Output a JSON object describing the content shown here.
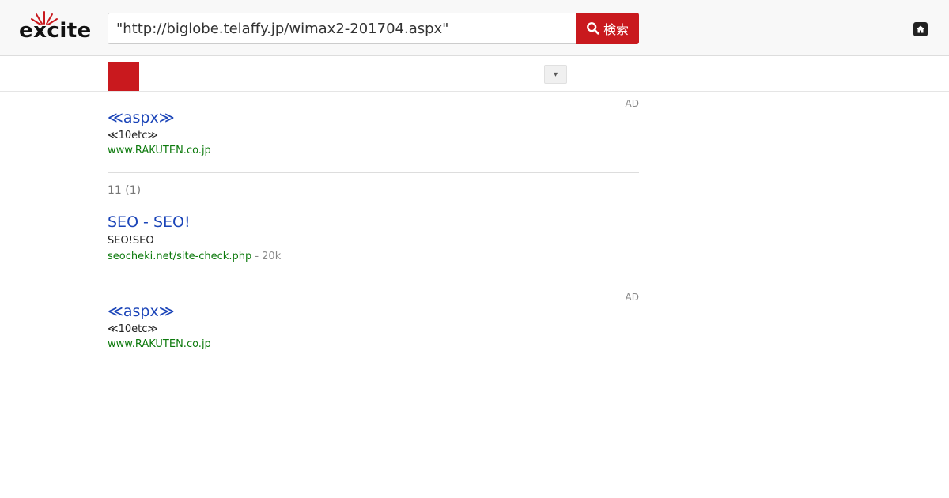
{
  "header": {
    "logo_text": "excite",
    "search_value": "\"http://biglobe.telaffy.jp/wimax2-201704.aspx\"",
    "search_button_label": "検索",
    "brand_color": "#c9191e"
  },
  "tabs": {
    "dropdown_label": "▾"
  },
  "results": {
    "ad_top": {
      "ad_label": "AD",
      "title": "≪aspx≫",
      "desc": "≪10etc≫",
      "url": "www.RAKUTEN.co.jp"
    },
    "count_text": "11 (1)",
    "organic": [
      {
        "title": "SEO - SEO!",
        "desc": "SEO!SEO",
        "url": "seocheki.net/site-check.php",
        "size": " - 20k"
      }
    ],
    "ad_bottom": {
      "ad_label": "AD",
      "title": "≪aspx≫",
      "desc": "≪10etc≫",
      "url": "www.RAKUTEN.co.jp"
    }
  },
  "icons": {
    "search": "search-icon",
    "home": "home-icon"
  }
}
